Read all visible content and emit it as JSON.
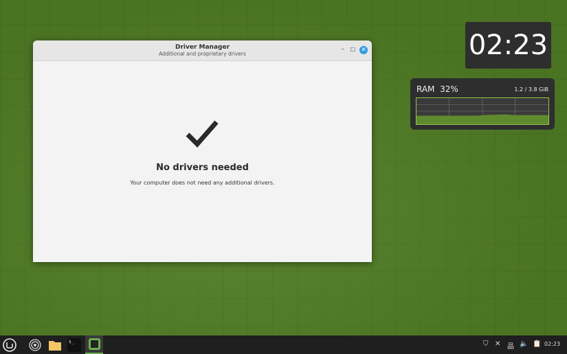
{
  "window": {
    "title": "Driver Manager",
    "subtitle": "Additional and proprietary drivers",
    "minimize": "–",
    "maximize": "□",
    "close": "✕",
    "heading": "No drivers needed",
    "message": "Your computer does not need any additional drivers."
  },
  "desklets": {
    "clock": "02:23",
    "ram_label": "RAM",
    "ram_percent": "32%",
    "ram_usage": "1.2 / 3.8 GiB"
  },
  "taskbar": {
    "time": "02:23",
    "terminal_glyph": "$_"
  },
  "colors": {
    "accent": "#2f9ae0",
    "graph": "#9bc14f"
  }
}
